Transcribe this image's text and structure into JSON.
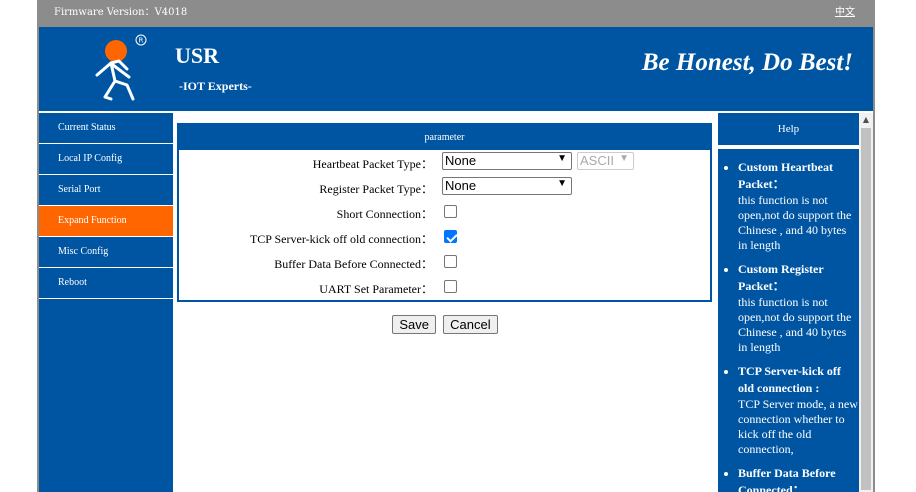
{
  "topbar": {
    "firmware": "Firmware Version：V4018",
    "lang_link": "中文"
  },
  "banner": {
    "brand": "USR",
    "subtitle": "-IOT Experts-",
    "slogan": "Be Honest, Do Best!"
  },
  "sidebar": {
    "items": [
      {
        "label": "Current Status",
        "active": false
      },
      {
        "label": "Local IP Config",
        "active": false
      },
      {
        "label": "Serial Port",
        "active": false
      },
      {
        "label": "Expand Function",
        "active": true
      },
      {
        "label": "Misc Config",
        "active": false
      },
      {
        "label": "Reboot",
        "active": false
      }
    ]
  },
  "params": {
    "header": "parameter",
    "heartbeat_label": "Heartbeat Packet Type：",
    "heartbeat_value": "None",
    "heartbeat_format": "ASCII",
    "register_label": "Register Packet Type：",
    "register_value": "None",
    "short_conn_label": "Short Connection：",
    "short_conn_checked": false,
    "kick_label": "TCP Server-kick off old connection：",
    "kick_checked": true,
    "buffer_label": "Buffer Data Before Connected：",
    "buffer_checked": false,
    "uart_label": "UART Set Parameter：",
    "uart_checked": false
  },
  "buttons": {
    "save": "Save",
    "cancel": "Cancel"
  },
  "help": {
    "title": "Help",
    "items": [
      {
        "title": "Custom Heartbeat Packet：",
        "text": "this function is not open,not do support the Chinese , and 40 bytes in length"
      },
      {
        "title": "Custom Register Packet：",
        "text": "this function is not open,not do support the Chinese , and 40 bytes in length"
      },
      {
        "title": "TCP Server-kick off old connection :",
        "text": "TCP Server mode, a new connection whether to kick off the old connection,"
      },
      {
        "title": "Buffer Data Before Connected：",
        "text": ""
      }
    ]
  },
  "colors": {
    "primary": "#0055a3",
    "active": "#ff6600",
    "logo_orange": "#ff6600",
    "frame": "#8c8c8c"
  },
  "icons": {
    "logo": "usr-runner-logo",
    "checkbox_checked": "check-icon",
    "select_arrow": "chevron-down-icon",
    "scroll_up": "scroll-up-arrow-icon"
  }
}
